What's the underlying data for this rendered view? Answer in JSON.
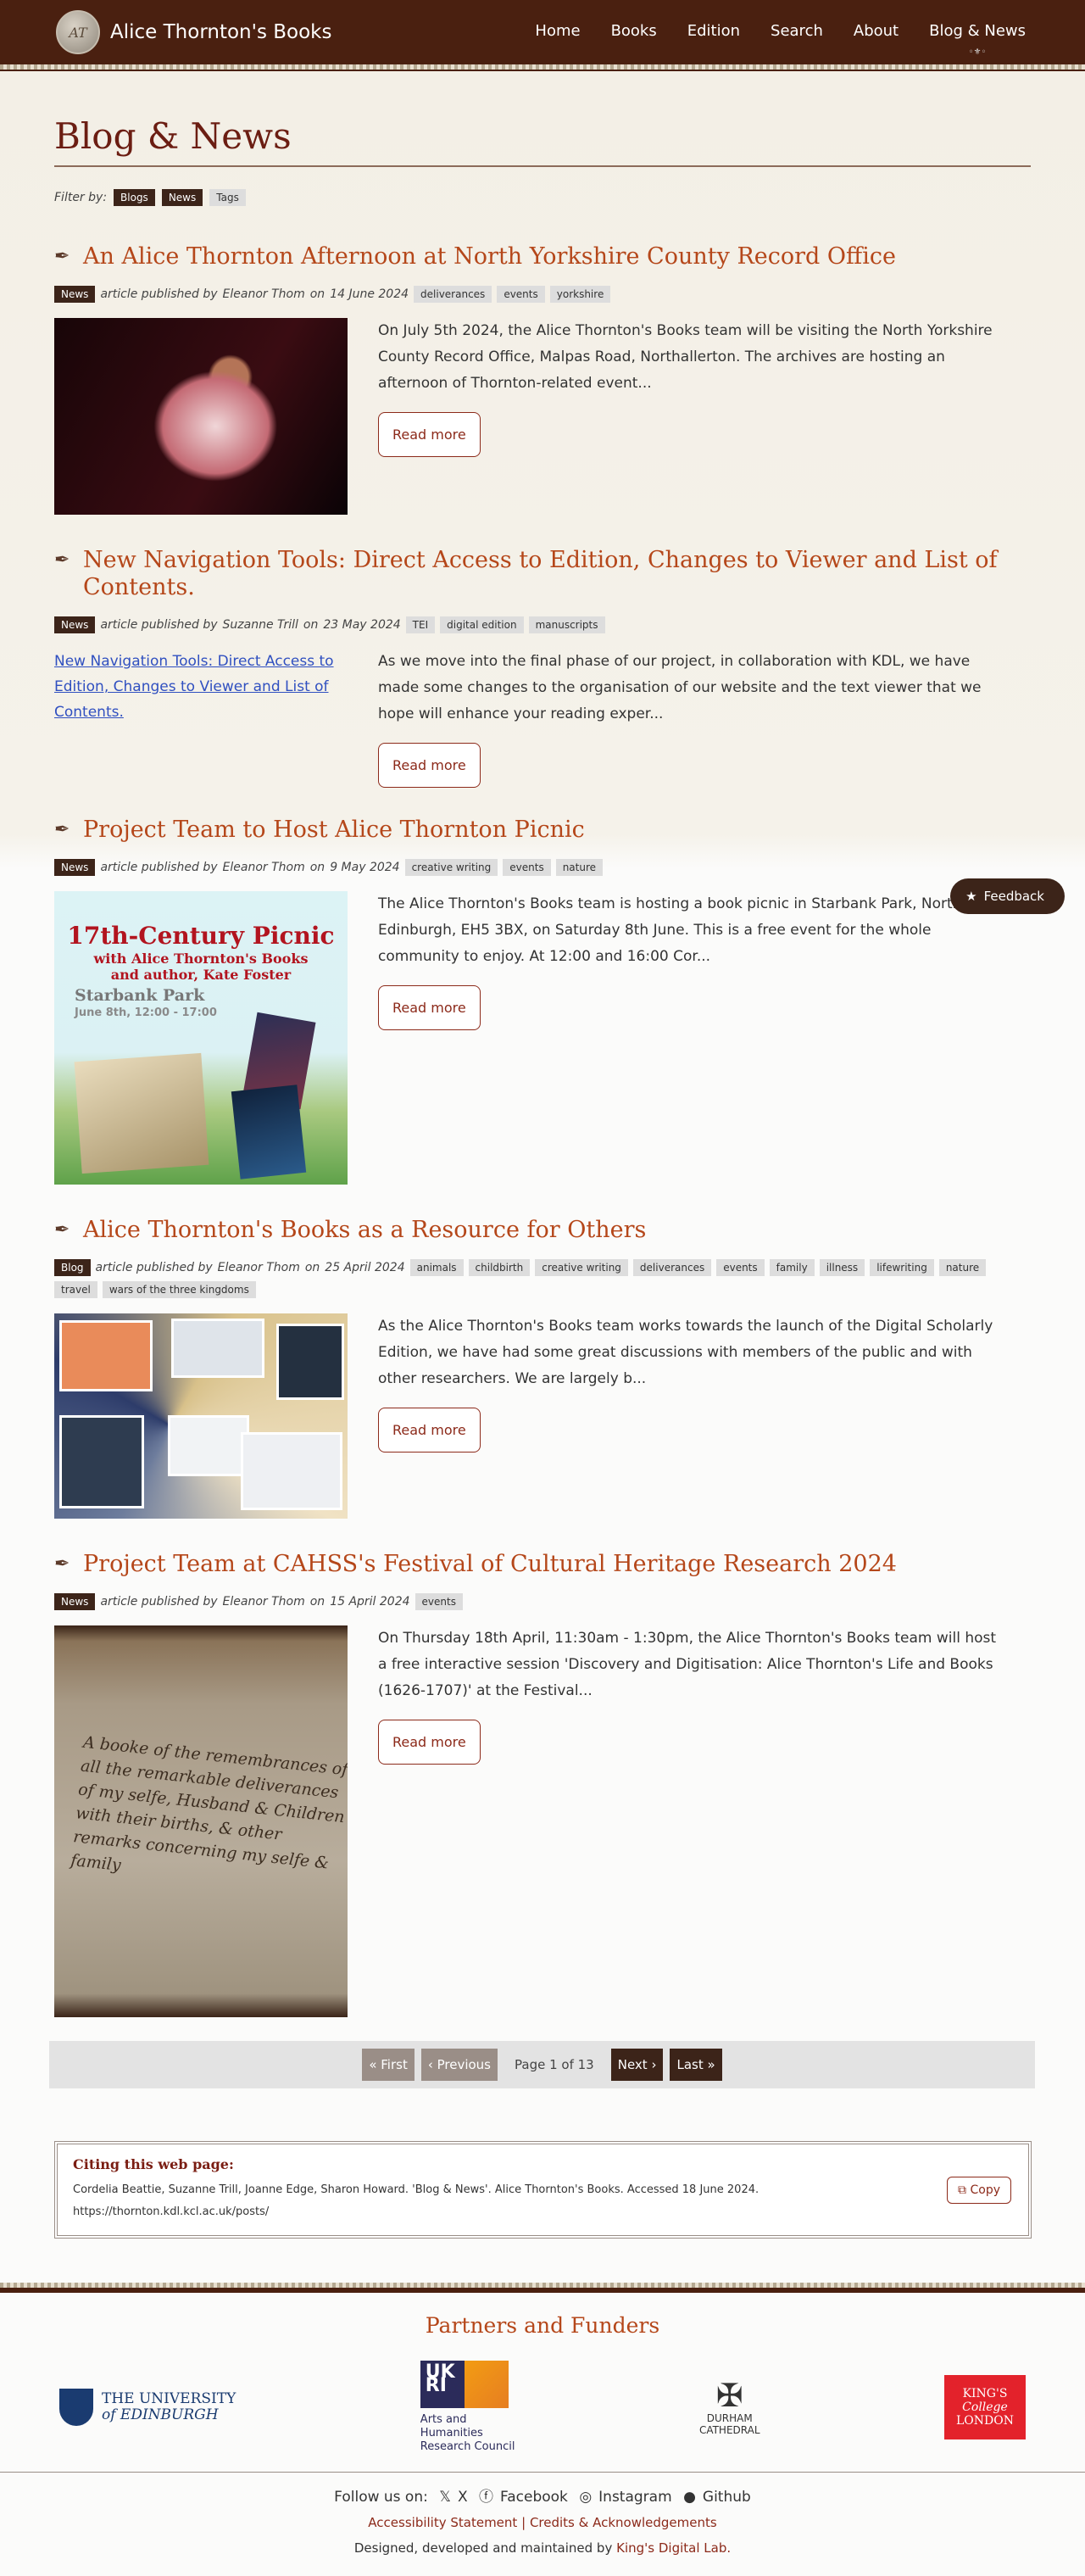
{
  "site": {
    "title": "Alice Thornton's Books",
    "logo_text": "AT"
  },
  "nav": [
    "Home",
    "Books",
    "Edition",
    "Search",
    "About",
    "Blog & News"
  ],
  "page_title": "Blog & News",
  "filter": {
    "label": "Filter by:",
    "options": [
      "Blogs",
      "News",
      "Tags"
    ]
  },
  "posts": [
    {
      "title": "An Alice Thornton Afternoon at North Yorkshire County Record Office",
      "type": "News",
      "byline": "article published by",
      "author": "Eleanor Thom",
      "on": "on",
      "date": "14 June 2024",
      "tags": [
        "deliverances",
        "events",
        "yorkshire"
      ],
      "excerpt": "On July 5th 2024, the Alice Thornton's Books team will be visiting the North Yorkshire County Record Office, Malpas Road, Northallerton. The archives are hosting an afternoon of Thornton-related event...",
      "read_more": "Read more"
    },
    {
      "title": "New Navigation Tools: Direct Access to Edition, Changes to Viewer and List of Contents.",
      "type": "News",
      "byline": "article published by",
      "author": "Suzanne Trill",
      "on": "on",
      "date": "23 May 2024",
      "tags": [
        "TEI",
        "digital edition",
        "manuscripts"
      ],
      "image_alt": "New Navigation Tools: Direct Access to Edition, Changes to Viewer and List of Contents.",
      "excerpt": "As we move into the final phase of our project, in collaboration with KDL, we have made some changes to the organisation of our website and the text viewer that we hope will enhance your reading exper...",
      "read_more": "Read more"
    },
    {
      "title": "Project Team to Host Alice Thornton Picnic",
      "type": "News",
      "byline": "article published by",
      "author": "Eleanor Thom",
      "on": "on",
      "date": "9 May 2024",
      "tags": [
        "creative writing",
        "events",
        "nature"
      ],
      "poster": {
        "heading": "17th-Century Picnic",
        "sub1": "with Alice Thornton's Books",
        "sub2": "and author, Kate Foster",
        "place": "Starbank Park",
        "when": "June 8th, 12:00 - 17:00"
      },
      "excerpt": "The Alice Thornton's Books team is hosting a book picnic in Starbank Park, North Edinburgh, EH5 3BX, on Saturday 8th June. This is a free event for the whole community to enjoy. At 12:00 and 16:00 Cor...",
      "read_more": "Read more"
    },
    {
      "title": "Alice Thornton's Books as a Resource for Others",
      "type": "Blog",
      "byline": "article published by",
      "author": "Eleanor Thom",
      "on": "on",
      "date": "25 April 2024",
      "tags": [
        "animals",
        "childbirth",
        "creative writing",
        "deliverances",
        "events",
        "family",
        "illness",
        "lifewriting",
        "nature",
        "travel",
        "wars of the three kingdoms"
      ],
      "excerpt": "As the Alice Thornton's Books team works towards the launch of the Digital Scholarly Edition, we have had some great discussions with members of the public and with other researchers. We are largely b...",
      "read_more": "Read more"
    },
    {
      "title": "Project Team at CAHSS's Festival of Cultural Heritage Research 2024",
      "type": "News",
      "byline": "article published by",
      "author": "Eleanor Thom",
      "on": "on",
      "date": "15 April 2024",
      "tags": [
        "events"
      ],
      "manuscript_text": "A booke of the remembrances of all the remarkable deliverances of my selfe, Husband & Children with their births, & other remarks concerning my selfe & family",
      "excerpt": "On Thursday 18th April, 11:30am - 1:30pm, the Alice Thornton's Books team will host a free interactive session 'Discovery and Digitisation: Alice Thornton's Life and Books (1626-1707)' at the Festival...",
      "read_more": "Read more"
    }
  ],
  "feedback": "Feedback",
  "pagination": {
    "first": "« First",
    "previous": "Previous",
    "status": "Page 1 of 13",
    "next": "Next",
    "last": "Last »"
  },
  "citation": {
    "heading": "Citing this web page:",
    "text": "Cordelia Beattie, Suzanne Trill, Joanne Edge, Sharon Howard. 'Blog & News'. Alice Thornton's Books. Accessed 18 June 2024.",
    "url": "https://thornton.kdl.kcl.ac.uk/posts/",
    "copy": "Copy"
  },
  "footer": {
    "partners_heading": "Partners and Funders",
    "partners": {
      "edinburgh": [
        "THE UNIVERSITY",
        "of EDINBURGH"
      ],
      "ukri": [
        "UK",
        "RI",
        "Arts and",
        "Humanities",
        "Research Council"
      ],
      "durham": [
        "DURHAM",
        "CATHEDRAL"
      ],
      "kings": [
        "KING'S",
        "College",
        "LONDON"
      ]
    },
    "follow": "Follow us on:",
    "social": [
      "X",
      "Facebook",
      "Instagram",
      "Github"
    ],
    "accessibility": "Accessibility Statement",
    "separator": "|",
    "credits": "Credits & Acknowledgements",
    "designed": "Designed, developed and maintained by",
    "kdl": "King's Digital Lab."
  }
}
